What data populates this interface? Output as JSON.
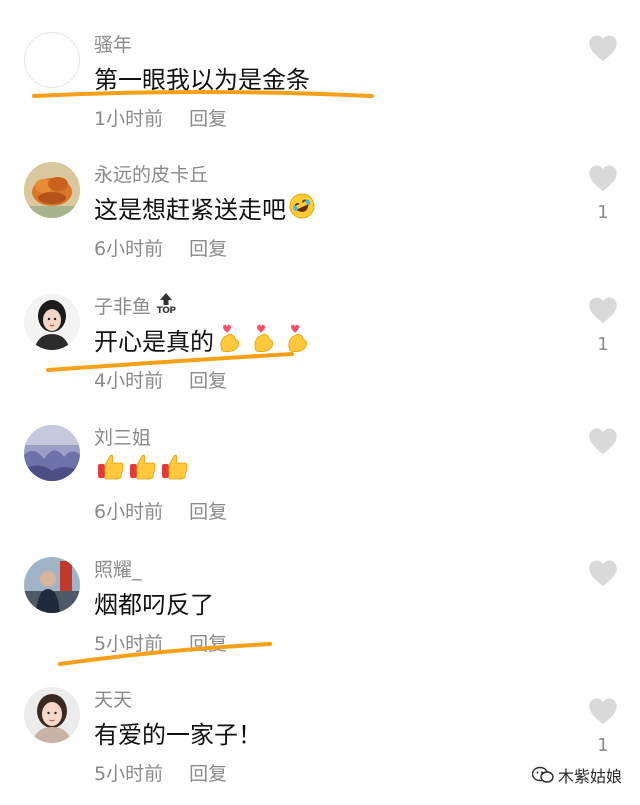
{
  "comments": [
    {
      "username": "骚年",
      "text": "第一眼我以为是金条",
      "time": "1小时前",
      "reply": "回复",
      "likes": ""
    },
    {
      "username": "永远的皮卡丘",
      "text": "这是想赶紧送走吧",
      "time": "6小时前",
      "reply": "回复",
      "likes": "1"
    },
    {
      "username": "子非鱼",
      "badge": "TOP",
      "text": "开心是真的",
      "time": "4小时前",
      "reply": "回复",
      "likes": "1"
    },
    {
      "username": "刘三姐",
      "text": "",
      "time": "6小时前",
      "reply": "回复",
      "likes": ""
    },
    {
      "username": "照耀_",
      "text": "烟都叼反了",
      "time": "5小时前",
      "reply": "回复",
      "likes": ""
    },
    {
      "username": "天天",
      "text": "有爱的一家子！",
      "time": "5小时前",
      "reply": "回复",
      "likes": "1"
    }
  ],
  "emojis": {
    "c2": [
      "rofl-emoji"
    ],
    "c3": [
      "finger-heart-emoji",
      "finger-heart-emoji",
      "finger-heart-emoji"
    ],
    "c4": [
      "thumbs-up-emoji",
      "thumbs-up-emoji",
      "thumbs-up-emoji"
    ]
  },
  "watermark": "木紫姑娘",
  "colors": {
    "accent_underline": "#f5a017",
    "meta_text": "#8a8a8a",
    "heart": "#d9d9d9"
  }
}
